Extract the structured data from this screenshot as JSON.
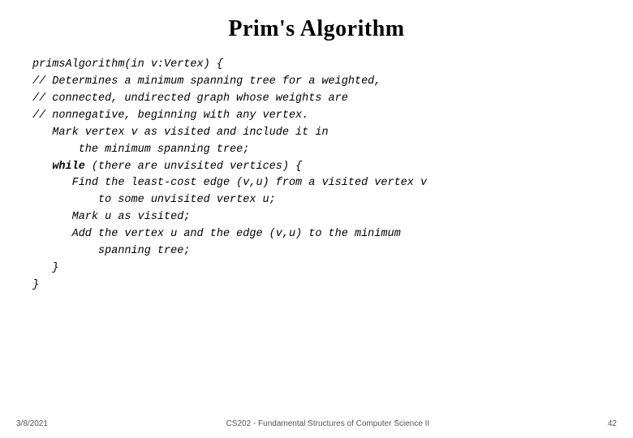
{
  "slide": {
    "title": "Prim's Algorithm",
    "code": {
      "lines": [
        {
          "indent": 0,
          "text": "primsAlgorithm(in v:Vertex) {",
          "bold_parts": []
        },
        {
          "indent": 0,
          "text": "// Determines a minimum spanning tree for a weighted,",
          "bold_parts": []
        },
        {
          "indent": 0,
          "text": "// connected, undirected graph whose weights are",
          "bold_parts": []
        },
        {
          "indent": 0,
          "text": "// nonnegative, beginning with any vertex.",
          "bold_parts": []
        },
        {
          "indent": 2,
          "text": "Mark vertex v as visited and include it in",
          "bold_parts": []
        },
        {
          "indent": 4,
          "text": "the minimum spanning tree;",
          "bold_parts": []
        },
        {
          "indent": 2,
          "text": "WHILE (there are unvisited vertices) {",
          "bold_parts": [
            "while"
          ]
        },
        {
          "indent": 4,
          "text": "Find the least-cost edge (v,u) from a visited vertex v",
          "bold_parts": []
        },
        {
          "indent": 6,
          "text": "to some unvisited vertex u;",
          "bold_parts": []
        },
        {
          "indent": 4,
          "text": "Mark u as visited;",
          "bold_parts": []
        },
        {
          "indent": 4,
          "text": "Add the vertex u and the edge (v,u) to the minimum",
          "bold_parts": []
        },
        {
          "indent": 6,
          "text": "spanning tree;",
          "bold_parts": []
        },
        {
          "indent": 2,
          "text": "}",
          "bold_parts": []
        },
        {
          "indent": 0,
          "text": "}",
          "bold_parts": []
        }
      ]
    },
    "footer": {
      "date": "3/8/2021",
      "course": "CS202 - Fundamental Structures of Computer Science II",
      "page": "42"
    }
  }
}
